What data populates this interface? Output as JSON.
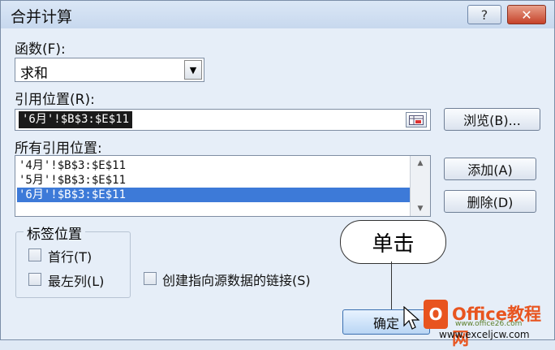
{
  "dialog": {
    "title": "合并计算",
    "help_label": "?",
    "close_label": "✕"
  },
  "function": {
    "label": "函数(F):",
    "value": "求和"
  },
  "reference": {
    "label": "引用位置(R):",
    "value": "'6月'!$B$3:$E$11",
    "browse_label": "浏览(B)..."
  },
  "all_references": {
    "label": "所有引用位置:",
    "items": [
      "'4月'!$B$3:$E$11",
      "'5月'!$B$3:$E$11",
      "'6月'!$B$3:$E$11"
    ],
    "selected_index": 2,
    "add_label": "添加(A)",
    "delete_label": "删除(D)"
  },
  "labels_group": {
    "title": "标签位置",
    "top_row_label": "首行(T)",
    "left_column_label": "最左列(L)"
  },
  "link_label": "创建指向源数据的链接(S)",
  "ok_label": "确定",
  "annotation": {
    "callout_text": "单击"
  },
  "watermark": {
    "brand": "Office教程网",
    "site1": "www.office26.com",
    "site2": "www.exceljcw.com"
  },
  "colors": {
    "selection": "#3d7ad8",
    "accent": "#e8541f"
  }
}
